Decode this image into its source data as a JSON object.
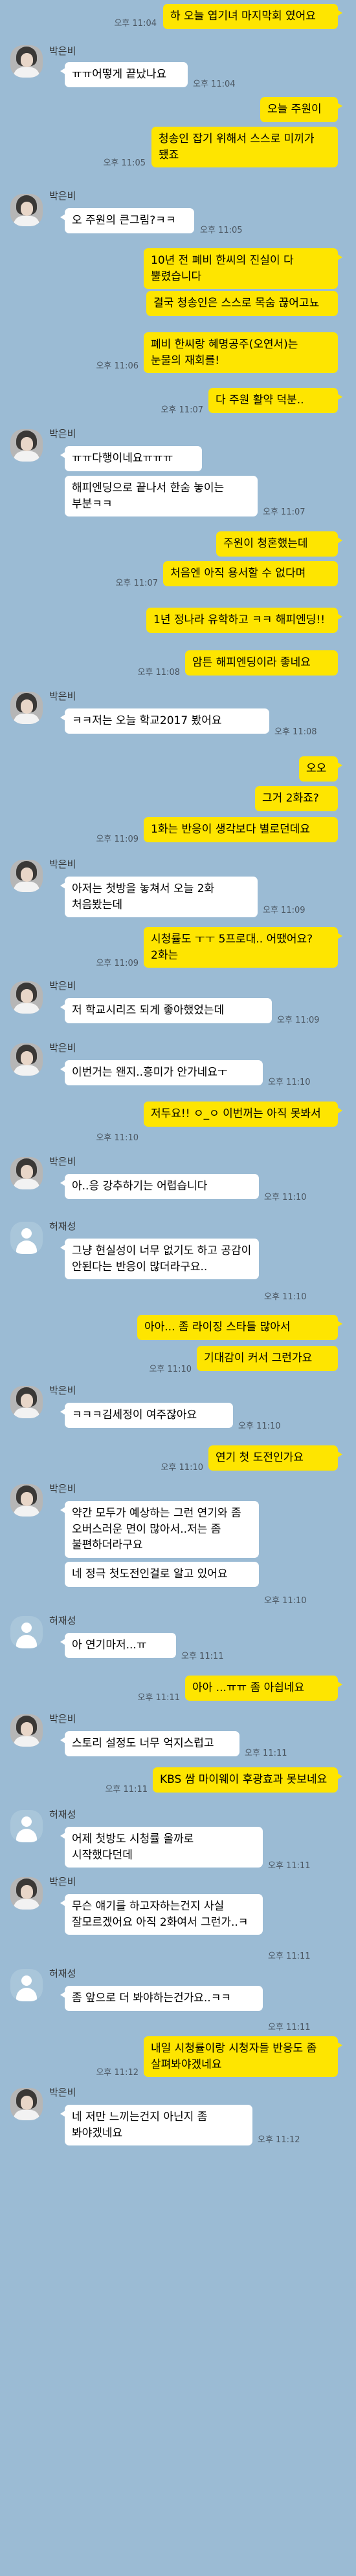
{
  "colors": {
    "background": "#9bbbd4",
    "my_bubble": "#fee500",
    "other_bubble": "#ffffff"
  },
  "messages": [
    {
      "type": "me",
      "text": "하 오늘 엽기녀 마지막회 였어요",
      "time": "오후 11:04"
    },
    {
      "type": "other",
      "sender": "박은비",
      "avatar": "photo",
      "text": "ㅠㅠ어떻게 끝났나요",
      "time": "오후 11:04"
    },
    {
      "type": "me",
      "text": "오늘 주원이",
      "time": ""
    },
    {
      "type": "me",
      "text": "청송인 잡기 위해서 스스로 미끼가 됐죠",
      "time": "오후 11:05"
    },
    {
      "type": "other",
      "sender": "박은비",
      "avatar": "photo",
      "text": "오 주원의 큰그림?ㅋㅋ",
      "time": "오후 11:05"
    },
    {
      "type": "me",
      "text": "10년 전 폐비 한씨의 진실이 다 뿔렸습니다",
      "time": ""
    },
    {
      "type": "me",
      "text": "결국 청송인은 스스로 목숨 끊어고뇨",
      "time": ""
    },
    {
      "type": "me",
      "text": "폐비 한씨랑 혜명공주(오연서)는 눈물의 재회를!",
      "time": "오후 11:06"
    },
    {
      "type": "me",
      "text": "다 주원 활약 덕분..",
      "time": "오후 11:07"
    },
    {
      "type": "other",
      "sender": "박은비",
      "avatar": "photo",
      "text": "ㅠㅠ다행이네요ㅠㅠㅠ",
      "time": ""
    },
    {
      "type": "other_cont",
      "text": "해피엔딩으로 끝나서 한숨 놓이는 부분ㅋㅋ",
      "time": "오후 11:07"
    },
    {
      "type": "me",
      "text": "주원이 청혼했는데",
      "time": ""
    },
    {
      "type": "me",
      "text": "처음엔 아직 용서할 수 없다며",
      "time": "오후 11:07"
    },
    {
      "type": "me",
      "text": "1년 정나라 유학하고 ㅋㅋ 해피엔딩!!",
      "time": ""
    },
    {
      "type": "me",
      "text": "암튼 해피엔딩이라 좋네요",
      "time": "오후 11:08"
    },
    {
      "type": "other",
      "sender": "박은비",
      "avatar": "photo",
      "text": "ㅋㅋ저는 오늘 학교2017 봤어요",
      "time": "오후 11:08"
    },
    {
      "type": "me",
      "text": "오오",
      "time": ""
    },
    {
      "type": "me",
      "text": "그거 2화죠?",
      "time": ""
    },
    {
      "type": "me",
      "text": "1화는 반응이 생각보다 별로던데요",
      "time": "오후 11:09"
    },
    {
      "type": "other",
      "sender": "박은비",
      "avatar": "photo",
      "text": "아저는 첫방을 놓쳐서 오늘 2화 처음봤는데",
      "time": "오후 11:09"
    },
    {
      "type": "me",
      "text": "시청률도 ㅜㅜ 5프로대.. 어땠어요? 2화는",
      "time": "오후 11:09"
    },
    {
      "type": "other",
      "sender": "박은비",
      "avatar": "photo",
      "text": "저 학교시리즈 되게 좋아했었는데",
      "time": "오후 11:09"
    },
    {
      "type": "other",
      "sender": "박은비",
      "avatar": "photo",
      "text": "이번거는 왠지..흥미가 안가네요ㅜ",
      "time": "오후 11:10"
    },
    {
      "type": "me",
      "text": "저두요!! ㅇ_ㅇ 이번꺼는 아직 못봐서",
      "time": "오후 11:10"
    },
    {
      "type": "other",
      "sender": "박은비",
      "avatar": "photo",
      "text": "아..응 강추하기는 어렵습니다",
      "time": "오후 11:10"
    },
    {
      "type": "other",
      "sender": "허재성",
      "avatar": "default",
      "text": "그냥 현실성이 너무 없기도 하고 공감이 안된다는 반응이 많더라구요..",
      "time": "오후 11:10"
    },
    {
      "type": "me",
      "text": "아아... 좀 라이징 스타들 많아서",
      "time": ""
    },
    {
      "type": "me",
      "text": "기대감이 커서 그런가요",
      "time": "오후 11:10"
    },
    {
      "type": "other",
      "sender": "박은비",
      "avatar": "photo",
      "text": "ㅋㅋㅋ김세정이 여주잖아요",
      "time": "오후 11:10"
    },
    {
      "type": "me",
      "text": "연기 첫 도전인가요",
      "time": "오후 11:10"
    },
    {
      "type": "other",
      "sender": "박은비",
      "avatar": "photo",
      "text": "약간 모두가 예상하는 그런 연기와 좀 오버스러운 면이 많아서..저는 좀 불편하더라구요",
      "time": ""
    },
    {
      "type": "other_cont",
      "text": "네 정극 첫도전인걸로 알고 있어요",
      "time": "오후 11:10"
    },
    {
      "type": "other",
      "sender": "허재성",
      "avatar": "default",
      "text": "아 연기마저...ㅠ",
      "time": "오후 11:11"
    },
    {
      "type": "me",
      "text": "아아 ...ㅠㅠ 좀 아쉽네요",
      "time": "오후 11:11"
    },
    {
      "type": "other",
      "sender": "박은비",
      "avatar": "photo",
      "text": "스토리 설정도 너무 억지스럽고",
      "time": "오후 11:11"
    },
    {
      "type": "me",
      "text": "KBS 쌈 마이웨이 후광효과 못보네요",
      "time": "오후 11:11"
    },
    {
      "type": "other",
      "sender": "허재성",
      "avatar": "default",
      "text": "어제 첫방도 시청률 올까로 시작했다던데",
      "time": "오후 11:11"
    },
    {
      "type": "other",
      "sender": "박은비",
      "avatar": "photo",
      "text": "무슨 얘기를 하고자하는건지 사실 잘모르겠어요 아직 2화여서 그런가..ㅋ",
      "time": "오후 11:11"
    },
    {
      "type": "other",
      "sender": "허재성",
      "avatar": "default",
      "text": "좀 앞으로 더 봐야하는건가요..ㅋㅋ",
      "time": "오후 11:11"
    },
    {
      "type": "me",
      "text": "내일 시청률이랑 시청자들 반응도 좀 살펴봐야겠네요",
      "time": "오후 11:12"
    },
    {
      "type": "other",
      "sender": "박은비",
      "avatar": "photo",
      "text": "네 저만 느끼는건지 아닌지 좀 봐야겠네요",
      "time": "오후 11:12"
    }
  ]
}
